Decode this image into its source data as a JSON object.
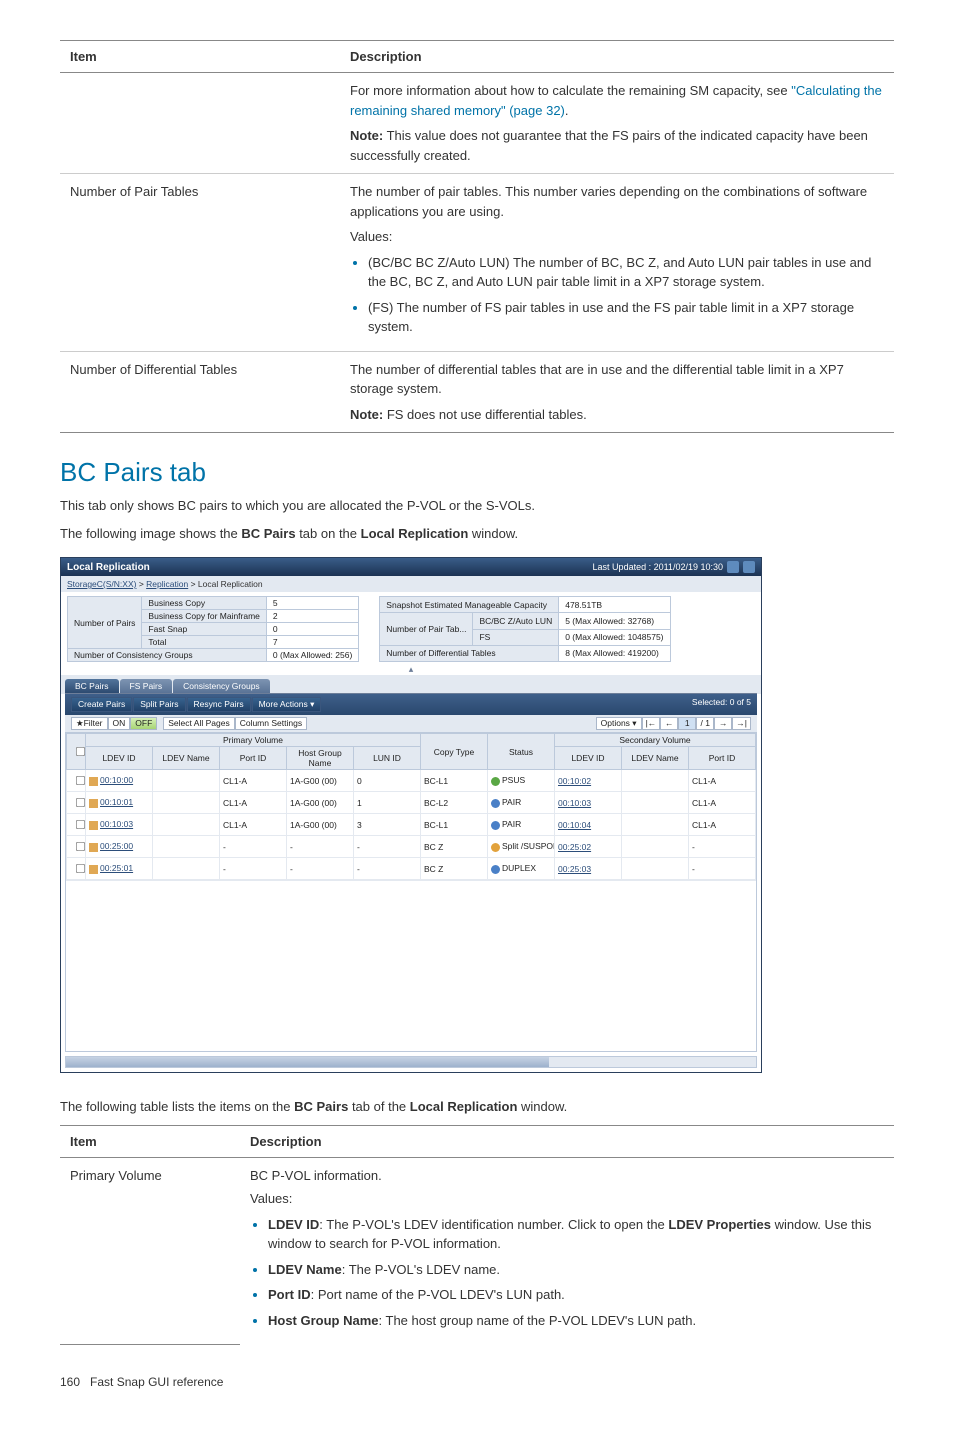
{
  "table1": {
    "h_item": "Item",
    "h_desc": "Description",
    "r0_desc_pre": "For more information about how to calculate the remaining SM capacity, see ",
    "r0_link": "\"Calculating the remaining shared memory\" (page 32)",
    "r0_dot": ".",
    "r0_note_b": "Note:",
    "r0_note": " This value does not guarantee that the FS pairs of the indicated capacity have been successfully created.",
    "r1_item": "Number of Pair Tables",
    "r1_desc1": "The number of pair tables. This number varies depending on the combinations of software applications you are using.",
    "r1_values": "Values:",
    "r1_b1": "(BC/BC BC Z/Auto LUN) The number of BC, BC Z, and Auto LUN pair tables in use and the BC, BC Z, and Auto LUN pair table limit in a XP7 storage system.",
    "r1_b2": "(FS) The number of FS pair tables in use and the FS pair table limit in a XP7 storage system.",
    "r2_item": "Number of Differential Tables",
    "r2_desc": "The number of differential tables that are in use and the differential table limit in a XP7 storage system.",
    "r2_note_b": "Note:",
    "r2_note": " FS does not use differential tables."
  },
  "section_title": "BC Pairs tab",
  "intro1": "This tab only shows BC pairs to which you are allocated the P-VOL or the S-VOLs.",
  "intro2_a": "The following image shows the ",
  "intro2_b": "BC Pairs",
  "intro2_c": " tab on the ",
  "intro2_d": "Local Replication",
  "intro2_e": " window.",
  "ui": {
    "title": "Local Replication",
    "updated": "Last Updated : 2011/02/19 10:30",
    "bc_a": "StorageC(S/N:XX)",
    "bc_b": "Replication",
    "bc_c": "Local Replication",
    "sum_l": {
      "h": "Number of Pairs",
      "r1a": "Business Copy",
      "r1b": "5",
      "r2a": "Business Copy for Mainframe",
      "r2b": "2",
      "r3a": "Fast Snap",
      "r3b": "0",
      "r4a": "Total",
      "r4b": "7",
      "r5a": "Number of Consistency Groups",
      "r5b": "0 (Max Allowed: 256)"
    },
    "sum_r": {
      "r1a": "Snapshot Estimated Manageable Capacity",
      "r1b": "478.51TB",
      "r2a": "Number of Pair Tab...",
      "r2b": "BC/BC Z/Auto LUN",
      "r2c": "5 (Max Allowed: 32768)",
      "r3b": "FS",
      "r3c": "0 (Max Allowed: 1048575)",
      "r4a": "Number of Differential Tables",
      "r4c": "8 (Max Allowed: 419200)"
    },
    "tabs": {
      "t1": "BC Pairs",
      "t2": "FS Pairs",
      "t3": "Consistency Groups"
    },
    "toolbar": {
      "b1": "Create Pairs",
      "b2": "Split Pairs",
      "b3": "Resync Pairs",
      "b4": "More Actions  ▾",
      "sel": "Selected: 0  of 5"
    },
    "filter": {
      "f": "★Filter",
      "on": "ON",
      "off": "OFF",
      "sap": "Select All Pages",
      "cs": "Column Settings",
      "opt": "Options ▾",
      "p1": "|←",
      "p2": "←",
      "page": "1",
      "p3": "/ 1",
      "p4": "→",
      "p5": "→|"
    },
    "cols": {
      "pv": "Primary Volume",
      "sv": "Secondary Volume",
      "c1": "LDEV ID",
      "c2": "LDEV Name",
      "c3": "Port ID",
      "c4": "Host Group Name",
      "c5": "LUN ID",
      "c6": "Copy Type",
      "c7": "Status",
      "c8": "LDEV ID",
      "c9": "LDEV Name",
      "c10": "Port ID"
    },
    "rows": [
      {
        "a": "00:10:00",
        "c": "CL1-A",
        "d": "1A-G00 (00)",
        "e": "0",
        "f": "BC-L1",
        "g": "PSUS",
        "h": "00:10:02",
        "j": "CL1-A"
      },
      {
        "a": "00:10:01",
        "c": "CL1-A",
        "d": "1A-G00 (00)",
        "e": "1",
        "f": "BC-L2",
        "g": "PAIR",
        "h": "00:10:03",
        "j": "CL1-A"
      },
      {
        "a": "00:10:03",
        "c": "CL1-A",
        "d": "1A-G00 (00)",
        "e": "3",
        "f": "BC-L1",
        "g": "PAIR",
        "h": "00:10:04",
        "j": "CL1-A"
      },
      {
        "a": "00:25:00",
        "c": "-",
        "d": "-",
        "e": "-",
        "f": "BC Z",
        "g": "Split /SUSPOP",
        "h": "00:25:02",
        "j": "-"
      },
      {
        "a": "00:25:01",
        "c": "-",
        "d": "-",
        "e": "-",
        "f": "BC Z",
        "g": "DUPLEX",
        "h": "00:25:03",
        "j": "-"
      }
    ],
    "arrow": "▴"
  },
  "after_img_a": "The following table lists the items on the ",
  "after_img_b": "BC Pairs",
  "after_img_c": " tab of the ",
  "after_img_d": "Local Replication",
  "after_img_e": " window.",
  "table2": {
    "h_item": "Item",
    "h_desc": "Description",
    "r1_item": "Primary Volume",
    "r1_d1": "BC P-VOL information.",
    "r1_values": "Values:",
    "b1_b": "LDEV ID",
    "b1": ": The P-VOL's LDEV identification number. Click to open the ",
    "b1_b2": "LDEV Properties",
    "b1_2": " window. Use this window to search for P-VOL information.",
    "b2_b": "LDEV Name",
    "b2": ": The P-VOL's LDEV name.",
    "b3_b": "Port ID",
    "b3": ": Port name of the P-VOL LDEV's LUN path.",
    "b4_b": "Host Group Name",
    "b4": ": The host group name of the P-VOL LDEV's LUN path."
  },
  "footer": {
    "page": "160",
    "label": "Fast Snap GUI reference"
  }
}
